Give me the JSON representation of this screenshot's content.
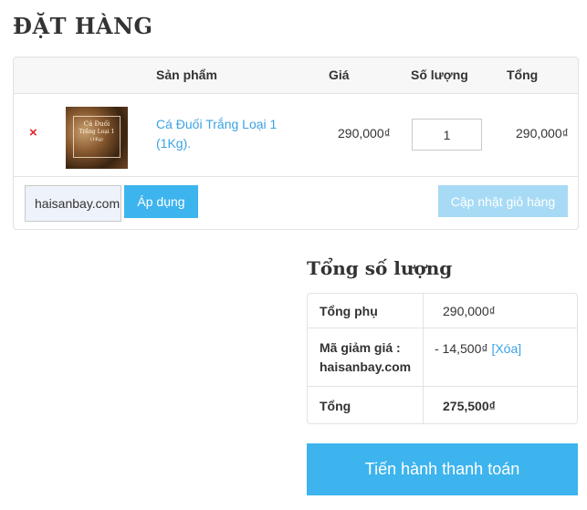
{
  "page": {
    "title": "ĐẶT HÀNG"
  },
  "cart": {
    "headers": {
      "product": "Sản phẩm",
      "price": "Giá",
      "quantity": "Số lượng",
      "total": "Tổng"
    },
    "items": [
      {
        "remove_icon": "×",
        "thumbnail_text": [
          "Cá Đuối",
          "Trắng Loại 1",
          "(1Kg)"
        ],
        "name": "Cá Đuối Trắng Loại 1 (1Kg).",
        "price": "290,000₫",
        "quantity": "1",
        "total": "290,000₫"
      }
    ],
    "coupon_value": "haisanbay.com",
    "apply_label": "Áp dụng",
    "update_label": "Cập nhật giỏ hàng"
  },
  "totals": {
    "title": "Tổng số lượng",
    "subtotal_label": "Tổng phụ",
    "subtotal_value": "290,000₫",
    "coupon_label": "Mã giảm giá : haisanbay.com",
    "coupon_value": "-  14,500₫",
    "coupon_remove": "[Xóa]",
    "total_label": "Tổng",
    "total_value": "275,500₫"
  },
  "checkout": {
    "label": "Tiến hành thanh toán"
  },
  "colors": {
    "accent": "#3db4ee",
    "accent_light": "#a7dbf5",
    "link": "#3aa3e3",
    "remove": "#e0242a"
  }
}
